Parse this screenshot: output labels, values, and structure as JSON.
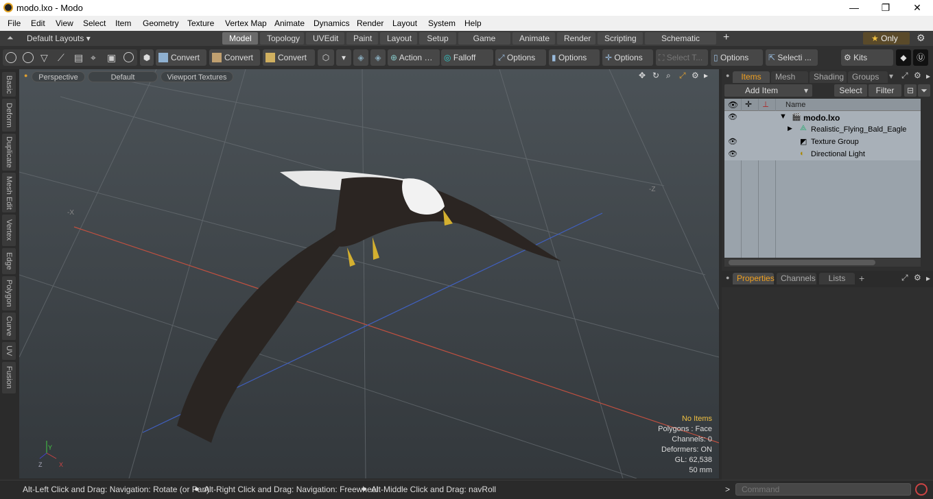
{
  "window": {
    "title": "modo.lxo - Modo",
    "controls": [
      "—",
      "❐",
      "✕"
    ]
  },
  "menu": [
    "File",
    "Edit",
    "View",
    "Select",
    "Item",
    "Geometry",
    "Texture",
    "Vertex Map",
    "Animate",
    "Dynamics",
    "Render",
    "Layout",
    "System",
    "Help"
  ],
  "layouts": {
    "dropdown": "Default Layouts ▾",
    "tabs": [
      "Model",
      "Topology",
      "UVEdit",
      "Paint",
      "Layout",
      "Setup",
      "Game Tools",
      "Animate",
      "Render",
      "Scripting",
      "Schematic Fusion"
    ],
    "active": "Model",
    "add": "+",
    "only": "Only"
  },
  "toolbar": {
    "convert1": "Convert",
    "convert2": "Convert",
    "convert3": "Convert",
    "action": "Action",
    "falloff": "Falloff",
    "options1": "Options",
    "options2": "Options",
    "options3": "Options",
    "options4": "Options",
    "select_t": "Select T...",
    "selecti": "Selecti ...",
    "kits": "Kits",
    "more": "…"
  },
  "left_tabs": [
    "Basic",
    "Deform",
    "Duplicate",
    "Mesh Edit",
    "Vertex",
    "Edge",
    "Polygon",
    "Curve",
    "UV",
    "Fusion"
  ],
  "viewport": {
    "buttons": [
      "Perspective",
      "Default",
      "Viewport Textures"
    ],
    "axis_x": "-X",
    "axis_z": "-Z",
    "gizmo": {
      "y": "Y",
      "z": "Z",
      "x": "X"
    },
    "info": {
      "items": "No Items",
      "polygons": "Polygons : Face",
      "channels": "Channels: 0",
      "deformers": "Deformers: ON",
      "gl": "GL: 62,538",
      "lens": "50 mm"
    }
  },
  "items_panel": {
    "tabs": [
      "Items",
      "Mesh ...",
      "Shading",
      "Groups"
    ],
    "add_item": "Add Item",
    "select": "Select",
    "filter": "Filter",
    "column_name": "Name",
    "rows": [
      {
        "label": "modo.lxo",
        "indent": 0,
        "visible": true
      },
      {
        "label": "Realistic_Flying_Bald_Eagle",
        "indent": 1,
        "visible": false
      },
      {
        "label": "Texture Group",
        "indent": 1,
        "visible": true
      },
      {
        "label": "Directional Light",
        "indent": 1,
        "visible": true
      }
    ]
  },
  "properties_panel": {
    "tabs": [
      "Properties",
      "Channels",
      "Lists"
    ],
    "add": "+"
  },
  "status": {
    "hint1": "Alt-Left Click and Drag: Navigation: Rotate (or Pan)",
    "hint2": "Alt-Right Click and Drag: Navigation: Freewheel",
    "hint3": "Alt-Middle Click and Drag: navRoll",
    "prompt": ">",
    "command_placeholder": "Command"
  }
}
